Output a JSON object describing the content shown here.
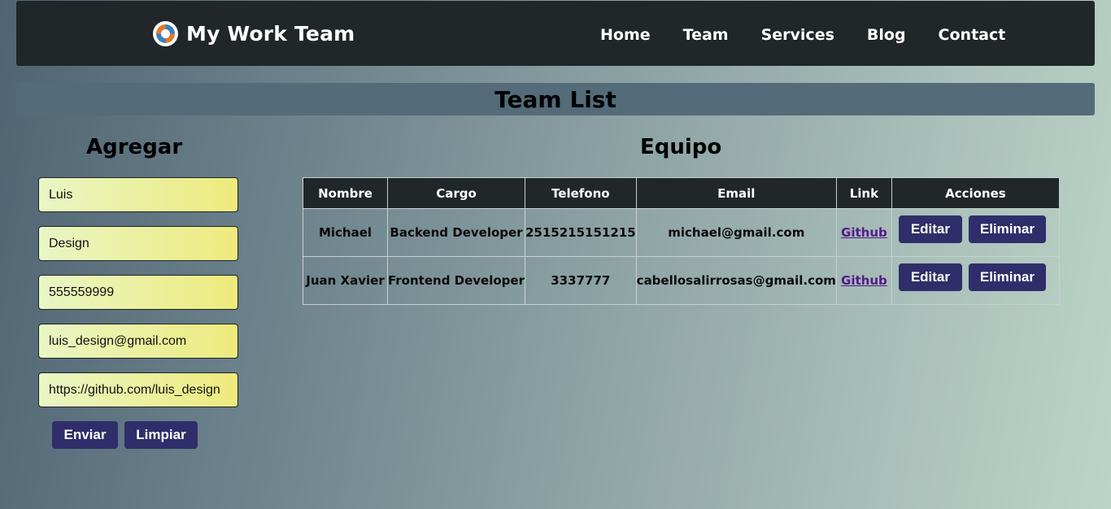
{
  "nav": {
    "brand": "My Work Team",
    "logo_icon": "react-swirl-logo-icon",
    "links": [
      "Home",
      "Team",
      "Services",
      "Blog",
      "Contact"
    ]
  },
  "page_title": "Team List",
  "form": {
    "title": "Agregar",
    "fields": {
      "nombre": "Luis",
      "cargo": "Design",
      "telefono": "555559999",
      "email": "luis_design@gmail.com",
      "link": "https://github.com/luis_design"
    },
    "submit_label": "Enviar",
    "clear_label": "Limpiar"
  },
  "team": {
    "title": "Equipo",
    "headers": [
      "Nombre",
      "Cargo",
      "Telefono",
      "Email",
      "Link",
      "Acciones"
    ],
    "rows": [
      {
        "nombre": "Michael",
        "cargo": "Backend Developer",
        "telefono": "2515215151215",
        "email": "michael@gmail.com",
        "link": "Github",
        "edit": "Editar",
        "delete": "Eliminar"
      },
      {
        "nombre": "Juan Xavier",
        "cargo": "Frontend Developer",
        "telefono": "3337777",
        "email": "cabellosalirrosas@gmail.com",
        "link": "Github",
        "edit": "Editar",
        "delete": "Eliminar"
      }
    ]
  },
  "colors": {
    "navbar": "#212628",
    "button": "#2f2e6a",
    "title_bar": "#546b79",
    "link_visited": "#551a8b"
  }
}
